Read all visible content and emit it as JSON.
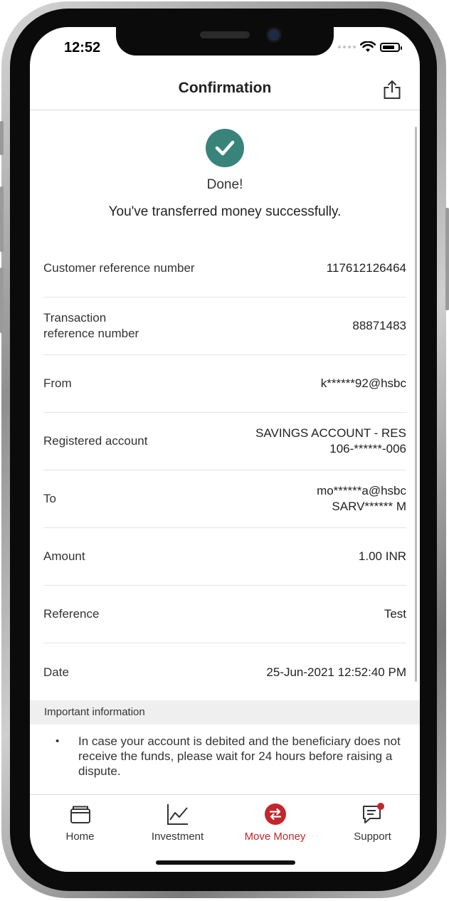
{
  "status_bar": {
    "time": "12:52"
  },
  "header": {
    "title": "Confirmation"
  },
  "result": {
    "heading": "Done!",
    "message": "You've transferred money successfully."
  },
  "details": [
    {
      "label": "Customer reference number",
      "value": "117612126464"
    },
    {
      "label": "Transaction\nreference number",
      "value": "88871483"
    },
    {
      "label": "From",
      "value": "k******92@hsbc"
    },
    {
      "label": "Registered account",
      "value": "SAVINGS ACCOUNT - RES\n106-******-006"
    },
    {
      "label": "To",
      "value": "mo******a@hsbc\nSARV****** M"
    },
    {
      "label": "Amount",
      "value": "1.00 INR"
    },
    {
      "label": "Reference",
      "value": "Test"
    },
    {
      "label": "Date",
      "value": "25-Jun-2021 12:52:40 PM"
    }
  ],
  "important": {
    "heading": "Important information",
    "items": [
      "In case your account is debited and the beneficiary does not receive the funds, please wait for 24 hours before raising a dispute."
    ]
  },
  "tabs": [
    {
      "label": "Home",
      "icon": "wallet-icon"
    },
    {
      "label": "Investment",
      "icon": "chart-icon"
    },
    {
      "label": "Move Money",
      "icon": "transfer-icon",
      "active": true
    },
    {
      "label": "Support",
      "icon": "chat-icon"
    }
  ],
  "colors": {
    "accent": "#c4262e",
    "success": "#38847a"
  }
}
